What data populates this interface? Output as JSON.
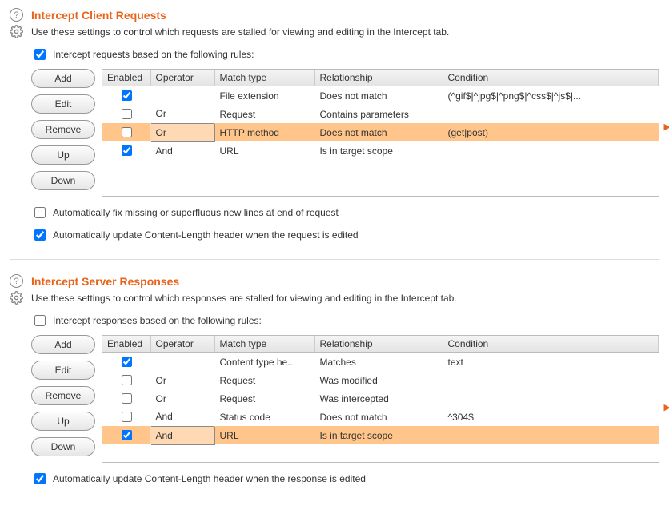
{
  "requests": {
    "title": "Intercept Client Requests",
    "desc": "Use these settings to control which requests are stalled for viewing and editing in the Intercept tab.",
    "rulesCheckbox": "Intercept requests based on the following rules:",
    "rulesChecked": true,
    "buttons": {
      "add": "Add",
      "edit": "Edit",
      "remove": "Remove",
      "up": "Up",
      "down": "Down"
    },
    "headers": {
      "enabled": "Enabled",
      "operator": "Operator",
      "matchType": "Match type",
      "relationship": "Relationship",
      "condition": "Condition"
    },
    "rows": [
      {
        "enabled": true,
        "operator": "",
        "matchType": "File extension",
        "relationship": "Does not match",
        "condition": "(^gif$|^jpg$|^png$|^css$|^js$|..."
      },
      {
        "enabled": false,
        "operator": "Or",
        "matchType": "Request",
        "relationship": "Contains parameters",
        "condition": ""
      },
      {
        "enabled": false,
        "operator": "Or",
        "matchType": "HTTP method",
        "relationship": "Does not match",
        "condition": "(get|post)"
      },
      {
        "enabled": true,
        "operator": "And",
        "matchType": "URL",
        "relationship": "Is in target scope",
        "condition": ""
      }
    ],
    "selectedRow": 2,
    "opt1": "Automatically fix missing or superfluous new lines at end of request",
    "opt1Checked": false,
    "opt2": "Automatically update Content-Length header when the request is edited",
    "opt2Checked": true
  },
  "responses": {
    "title": "Intercept Server Responses",
    "desc": "Use these settings to control which responses are stalled for viewing and editing in the Intercept tab.",
    "rulesCheckbox": "Intercept responses based on the following rules:",
    "rulesChecked": false,
    "buttons": {
      "add": "Add",
      "edit": "Edit",
      "remove": "Remove",
      "up": "Up",
      "down": "Down"
    },
    "headers": {
      "enabled": "Enabled",
      "operator": "Operator",
      "matchType": "Match type",
      "relationship": "Relationship",
      "condition": "Condition"
    },
    "rows": [
      {
        "enabled": true,
        "operator": "",
        "matchType": "Content type he...",
        "relationship": "Matches",
        "condition": "text"
      },
      {
        "enabled": false,
        "operator": "Or",
        "matchType": "Request",
        "relationship": "Was modified",
        "condition": ""
      },
      {
        "enabled": false,
        "operator": "Or",
        "matchType": "Request",
        "relationship": "Was intercepted",
        "condition": ""
      },
      {
        "enabled": false,
        "operator": "And",
        "matchType": "Status code",
        "relationship": "Does not match",
        "condition": "^304$"
      },
      {
        "enabled": true,
        "operator": "And",
        "matchType": "URL",
        "relationship": "Is in target scope",
        "condition": ""
      }
    ],
    "selectedRow": 4,
    "opt1": "Automatically update Content-Length header when the response is edited",
    "opt1Checked": true
  }
}
